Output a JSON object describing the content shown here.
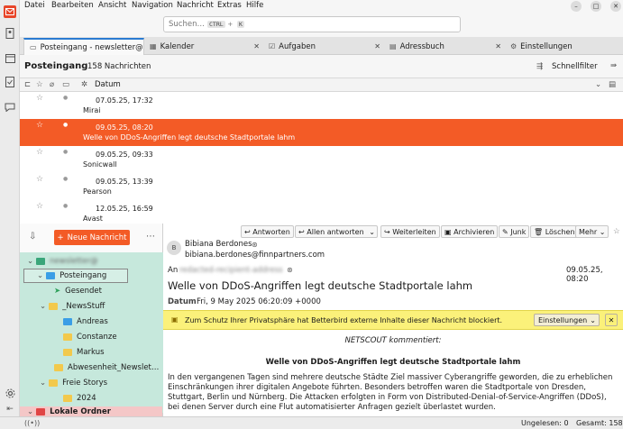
{
  "menubar": {
    "items": [
      "Datei",
      "Bearbeiten",
      "Ansicht",
      "Navigation",
      "Nachricht",
      "Extras",
      "Hilfe"
    ]
  },
  "search": {
    "placeholder": "Suchen…",
    "kbd1": "CTRL",
    "plus": "+",
    "kbd2": "K"
  },
  "tabs": [
    {
      "label": "Posteingang - newsletter@",
      "icon": "inbox-icon"
    },
    {
      "label": "Kalender",
      "icon": "calendar-icon"
    },
    {
      "label": "Aufgaben",
      "icon": "tasks-icon"
    },
    {
      "label": "Adressbuch",
      "icon": "addressbook-icon"
    },
    {
      "label": "Einstellungen",
      "icon": "gear-icon"
    }
  ],
  "folder_header": {
    "title": "Posteingang",
    "count": "158 Nachrichten",
    "quickfilter": "Schnellfilter"
  },
  "columns": {
    "date": "Datum"
  },
  "messages": [
    {
      "date": "07.05.25, 17:32",
      "sender": "Mirai",
      "selected": false
    },
    {
      "date": "09.05.25, 08:20",
      "sender": "Welle von DDoS-Angriffen legt deutsche Stadtportale lahm",
      "selected": true
    },
    {
      "date": "09.05.25, 09:33",
      "sender": "Sonicwall",
      "selected": false
    },
    {
      "date": "09.05.25, 13:39",
      "sender": "Pearson",
      "selected": false
    },
    {
      "date": "12.05.25, 16:59",
      "sender": "Avast",
      "selected": false
    }
  ],
  "folders": {
    "new_message": "Neue Nachricht",
    "account": "newsletter@",
    "items": [
      {
        "label": "Posteingang",
        "color": "#3a9ee6"
      },
      {
        "label": "Gesendet",
        "color": "#2ea05a"
      },
      {
        "label": "_NewsStuff",
        "color": "#f2c94c"
      },
      {
        "label": "Andreas",
        "color": "#3a9ee6"
      },
      {
        "label": "Constanze",
        "color": "#f2c94c"
      },
      {
        "label": "Markus",
        "color": "#f2c94c"
      },
      {
        "label": "Abwesenheit_Newslet…",
        "color": "#f2c94c"
      },
      {
        "label": "Freie Storys",
        "color": "#f2c94c"
      },
      {
        "label": "2024",
        "color": "#f2c94c"
      },
      {
        "label": "Lokale Ordner",
        "color": "#e04545"
      }
    ]
  },
  "reader": {
    "buttons": {
      "reply": "Antworten",
      "reply_all": "Allen antworten",
      "forward": "Weiterleiten",
      "archive": "Archivieren",
      "junk": "Junk",
      "delete": "Löschen",
      "more": "Mehr"
    },
    "avatar": "B",
    "from_name": "Bibiana Berdones",
    "from_email": "bibiana.berdones@finnpartners.com",
    "to_label": "An",
    "date_short": "09.05.25, 08:20",
    "subject": "Welle von DDoS-Angriffen legt deutsche Stadtportale lahm",
    "date_label": "Datum",
    "date_full": "Fri, 9 May 2025 06:20:09 +0000",
    "notice": "Zum Schutz Ihrer Privatsphäre hat Betterbird externe Inhalte dieser Nachricht blockiert.",
    "notice_button": "Einstellungen",
    "body_intro": "NETSCOUT kommentiert:",
    "body_heading": "Welle von DDoS-Angriffen legt deutsche Stadtportale lahm",
    "body_text": "In den vergangenen Tagen sind mehrere deutsche Städte Ziel massiver Cyberangriffe geworden, die zu erheblichen Einschränkungen ihrer digitalen Angebote führten. Besonders betroffen waren die Stadtportale von Dresden, Stuttgart, Berlin und Nürnberg. Die Attacken erfolgten in Form von Distributed-Denial-of-Service-Angriffen (DDoS), bei denen Server durch eine Flut automatisierter Anfragen gezielt überlastet wurden."
  },
  "status": {
    "unread": "Ungelesen: 0",
    "total": "Gesamt: 158"
  },
  "colors": {
    "accent": "#f35b26",
    "notice": "#fbf17a",
    "folder_selected": "#c6e8dc"
  }
}
